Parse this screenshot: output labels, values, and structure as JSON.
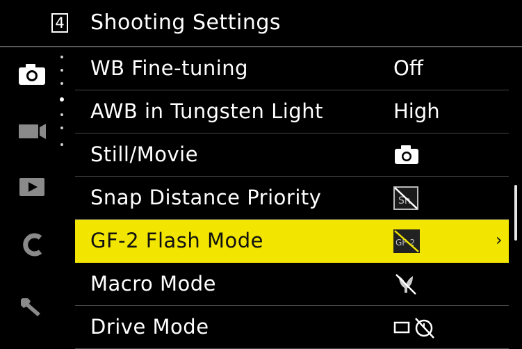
{
  "header": {
    "page_number": "4",
    "title": "Shooting Settings"
  },
  "tabs": [
    {
      "icon": "camera-icon",
      "active": true
    },
    {
      "icon": "movie-camera-icon",
      "active": false
    },
    {
      "icon": "playback-icon",
      "active": false
    },
    {
      "icon": "custom-c-icon",
      "active": false
    },
    {
      "icon": "wrench-icon",
      "active": false
    }
  ],
  "page_indicator": {
    "pages": 5,
    "current": 4
  },
  "menu": {
    "items": [
      {
        "label": "WB Fine-tuning",
        "value": "Off",
        "selected": false
      },
      {
        "label": "AWB in Tungsten Light",
        "value": "High",
        "selected": false
      },
      {
        "label": "Still/Movie",
        "value_icon": "still-camera-icon",
        "selected": false
      },
      {
        "label": "Snap Distance Priority",
        "value_icon": "snap-off-icon",
        "selected": false
      },
      {
        "label": "GF-2 Flash Mode",
        "value_icon": "gf2-off-icon",
        "selected": true
      },
      {
        "label": "Macro Mode",
        "value_icon": "macro-off-icon",
        "selected": false
      },
      {
        "label": "Drive Mode",
        "value_icon": "single-frame-self-timer-off-icon",
        "selected": false
      }
    ],
    "selected_chevron": "›"
  },
  "colors": {
    "background": "#000000",
    "highlight": "#f2e600",
    "text": "#ffffff",
    "divider": "#4a4a4a"
  }
}
